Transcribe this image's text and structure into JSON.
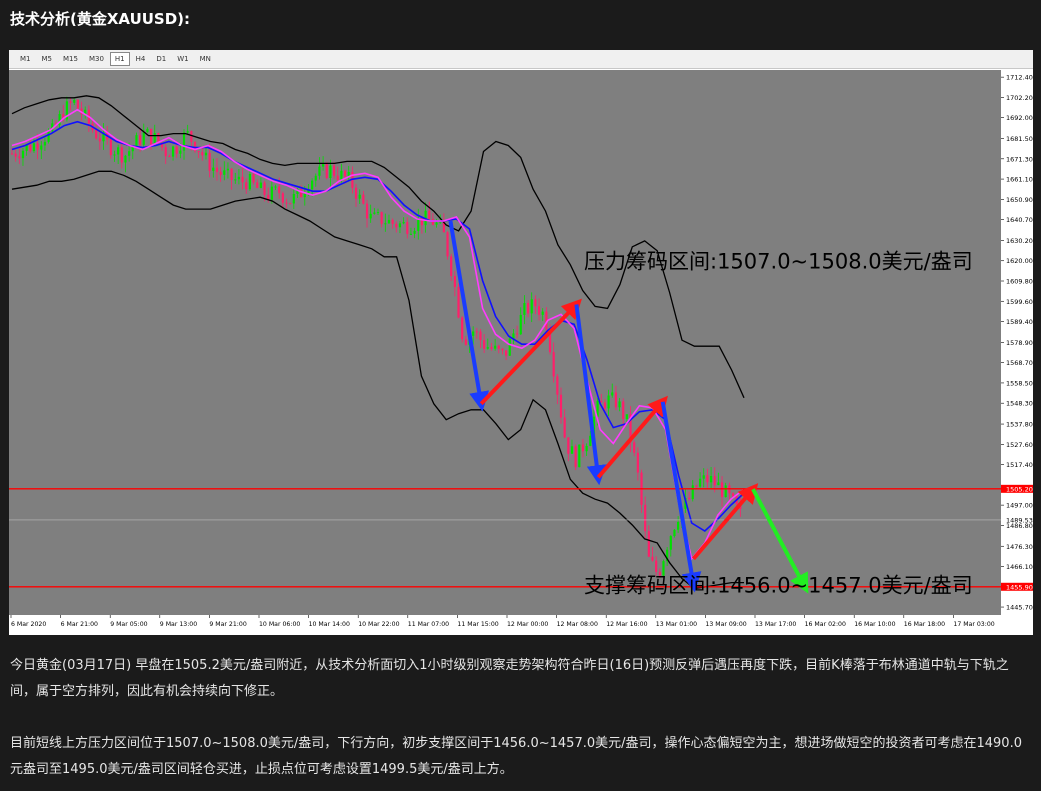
{
  "header": {
    "title": "技术分析(黄金XAUUSD):"
  },
  "toolbar": {
    "timeframes": [
      "M1",
      "M5",
      "M15",
      "M30",
      "H1",
      "H4",
      "D1",
      "W1",
      "MN"
    ],
    "active": "H1"
  },
  "colors": {
    "background": "#1b1b1b",
    "plot_bg": "#7f7f7f",
    "bull": "#00e000",
    "bear": "#ff1f6a",
    "bollinger": "#000000",
    "ma_fast": "#ff3cff",
    "ma_slow": "#1010ff",
    "level_line": "#ff0000",
    "arrow_down": "#1a3cff",
    "arrow_up": "#ff1a1a",
    "arrow_proj": "#22ee22"
  },
  "chart_data": {
    "type": "candlestick",
    "title": "",
    "xlabel": "",
    "ylabel": "",
    "ylim": [
      1441.7,
      1716.0
    ],
    "yticks": [
      "1712.40",
      "1702.20",
      "1692.00",
      "1681.50",
      "1671.30",
      "1661.10",
      "1650.90",
      "1640.70",
      "1630.20",
      "1620.00",
      "1609.80",
      "1599.60",
      "1589.40",
      "1578.90",
      "1568.70",
      "1558.50",
      "1548.30",
      "1537.80",
      "1527.60",
      "1517.40",
      "1497.00",
      "1486.80",
      "1476.30",
      "1466.10",
      "1455.90",
      "1445.70"
    ],
    "xticks": [
      "6 Mar 2020",
      "6 Mar 21:00",
      "9 Mar 05:00",
      "9 Mar 13:00",
      "9 Mar 21:00",
      "10 Mar 06:00",
      "10 Mar 14:00",
      "10 Mar 22:00",
      "11 Mar 07:00",
      "11 Mar 15:00",
      "12 Mar 00:00",
      "12 Mar 08:00",
      "12 Mar 16:00",
      "13 Mar 01:00",
      "13 Mar 09:00",
      "13 Mar 17:00",
      "16 Mar 02:00",
      "16 Mar 10:00",
      "16 Mar 18:00",
      "17 Mar 03:00"
    ],
    "current_price": "1489.53",
    "levels": [
      {
        "price": 1505.2,
        "label": "1505.20"
      },
      {
        "price": 1455.9,
        "label": "1455.90"
      }
    ],
    "annotations": {
      "resistance": "压力筹码区间:1507.0~1508.0美元/盎司",
      "support": "支撑筹码区间:1456.0~1457.0美元/盎司"
    },
    "close_path": [
      1674,
      1676,
      1678,
      1682,
      1685,
      1695,
      1700,
      1693,
      1685,
      1680,
      1676,
      1673,
      1679,
      1684,
      1681,
      1675,
      1677,
      1684,
      1678,
      1670,
      1665,
      1662,
      1660,
      1660,
      1656,
      1653,
      1655,
      1650,
      1653,
      1661,
      1664,
      1666,
      1663,
      1660,
      1650,
      1641,
      1641,
      1639,
      1638,
      1638,
      1641,
      1640,
      1635,
      1612,
      1580,
      1585,
      1578,
      1575,
      1572,
      1585,
      1595,
      1598,
      1592,
      1560,
      1528,
      1520,
      1530,
      1545,
      1550,
      1549,
      1538,
      1512,
      1470,
      1462,
      1480,
      1493,
      1500,
      1509,
      1510,
      1506,
      1500,
      1492
    ],
    "bb_upper": [
      1694,
      1697,
      1699,
      1701,
      1702,
      1702,
      1703,
      1702,
      1698,
      1693,
      1688,
      1683,
      1683,
      1684,
      1684,
      1682,
      1680,
      1679,
      1676,
      1674,
      1671,
      1669,
      1668,
      1669,
      1669,
      1669,
      1669,
      1670,
      1670,
      1670,
      1667,
      1662,
      1657,
      1650,
      1645,
      1638,
      1635,
      1645,
      1675,
      1680,
      1678,
      1672,
      1656,
      1645,
      1628,
      1618,
      1605,
      1597,
      1596,
      1608,
      1627,
      1630,
      1625,
      1604,
      1580,
      1577,
      1577,
      1577,
      1565,
      1551
    ],
    "bb_lower": [
      1656,
      1657,
      1658,
      1660,
      1660,
      1661,
      1663,
      1665,
      1665,
      1663,
      1660,
      1656,
      1652,
      1648,
      1646,
      1646,
      1646,
      1648,
      1650,
      1651,
      1652,
      1650,
      1646,
      1643,
      1640,
      1636,
      1632,
      1630,
      1628,
      1626,
      1622,
      1622,
      1600,
      1562,
      1548,
      1540,
      1543,
      1545,
      1545,
      1538,
      1530,
      1535,
      1550,
      1545,
      1528,
      1510,
      1503,
      1500,
      1498,
      1493,
      1487,
      1480,
      1478,
      1468,
      1460,
      1455,
      1456,
      1457,
      1458,
      1458
    ],
    "ma_fast": [
      1678,
      1680,
      1683,
      1686,
      1692,
      1696,
      1692,
      1686,
      1681,
      1678,
      1676,
      1679,
      1682,
      1678,
      1676,
      1678,
      1675,
      1670,
      1666,
      1663,
      1660,
      1658,
      1655,
      1653,
      1655,
      1660,
      1663,
      1664,
      1662,
      1652,
      1645,
      1641,
      1640,
      1640,
      1642,
      1632,
      1596,
      1583,
      1578,
      1576,
      1580,
      1590,
      1593,
      1586,
      1560,
      1535,
      1528,
      1538,
      1547,
      1546,
      1535,
      1498,
      1470,
      1478,
      1492,
      1500,
      1505
    ],
    "ma_slow": [
      1676,
      1678,
      1681,
      1684,
      1688,
      1690,
      1688,
      1684,
      1680,
      1678,
      1677,
      1678,
      1680,
      1678,
      1677,
      1677,
      1674,
      1670,
      1667,
      1664,
      1661,
      1659,
      1657,
      1655,
      1655,
      1658,
      1661,
      1662,
      1661,
      1655,
      1648,
      1643,
      1640,
      1640,
      1641,
      1636,
      1610,
      1592,
      1582,
      1578,
      1578,
      1585,
      1590,
      1588,
      1570,
      1548,
      1536,
      1538,
      1544,
      1545,
      1540,
      1512,
      1488,
      1484,
      1490,
      1497,
      1503
    ],
    "arrows": [
      {
        "type": "down",
        "from": [
          0.445,
          1640
        ],
        "to": [
          0.476,
          1548
        ]
      },
      {
        "type": "up",
        "from": [
          0.476,
          1548
        ],
        "to": [
          0.572,
          1598
        ]
      },
      {
        "type": "down",
        "from": [
          0.572,
          1598
        ],
        "to": [
          0.594,
          1511
        ]
      },
      {
        "type": "up",
        "from": [
          0.594,
          1511
        ],
        "to": [
          0.659,
          1549
        ]
      },
      {
        "type": "down",
        "from": [
          0.659,
          1549
        ],
        "to": [
          0.69,
          1457
        ]
      },
      {
        "type": "up",
        "from": [
          0.69,
          1470
        ],
        "to": [
          0.75,
          1505
        ]
      },
      {
        "type": "proj",
        "from": [
          0.75,
          1505
        ],
        "to": [
          0.802,
          1456
        ]
      }
    ]
  },
  "body": {
    "paragraph1": "今日黄金(03月17日) 早盘在1505.2美元/盎司附近，从技术分析面切入1小时级别观察走势架构符合昨日(16日)预测反弹后遇压再度下跌，目前K棒落于布林通道中轨与下轨之间，属于空方排列，因此有机会持续向下修正。",
    "paragraph2": "目前短线上方压力区间位于1507.0~1508.0美元/盎司，下行方向，初步支撑区间于1456.0~1457.0美元/盎司，操作心态偏短空为主，想进场做短空的投资者可考虑在1490.0元盎司至1495.0美元/盎司区间轻仓买进，止损点位可考虑设置1499.5美元/盎司上方。"
  }
}
